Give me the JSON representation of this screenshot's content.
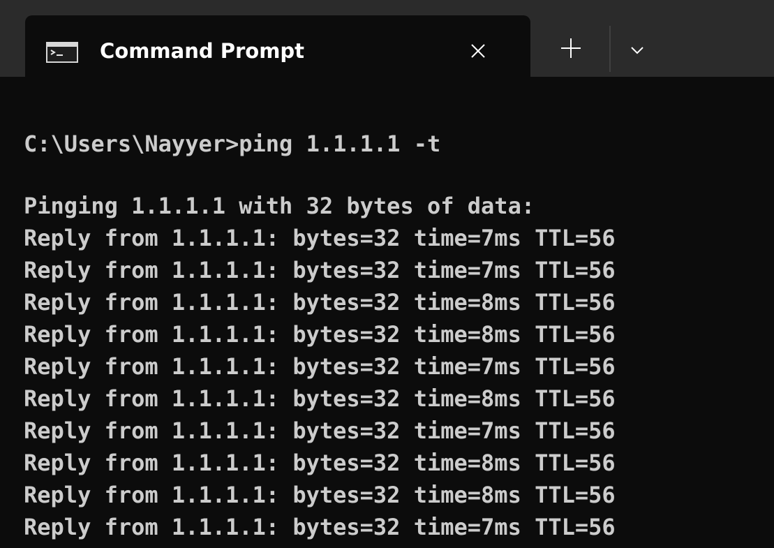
{
  "window": {
    "tab_title": "Command Prompt",
    "tab_icon": "cmd-icon",
    "close_icon": "close-icon",
    "new_tab_icon": "plus-icon",
    "dropdown_icon": "chevron-down-icon"
  },
  "terminal": {
    "command_line": "C:\\Users\\Nayyer>ping 1.1.1.1 -t",
    "header": "Pinging 1.1.1.1 with 32 bytes of data:",
    "replies": [
      "Reply from 1.1.1.1: bytes=32 time=7ms TTL=56",
      "Reply from 1.1.1.1: bytes=32 time=7ms TTL=56",
      "Reply from 1.1.1.1: bytes=32 time=8ms TTL=56",
      "Reply from 1.1.1.1: bytes=32 time=8ms TTL=56",
      "Reply from 1.1.1.1: bytes=32 time=7ms TTL=56",
      "Reply from 1.1.1.1: bytes=32 time=8ms TTL=56",
      "Reply from 1.1.1.1: bytes=32 time=7ms TTL=56",
      "Reply from 1.1.1.1: bytes=32 time=8ms TTL=56",
      "Reply from 1.1.1.1: bytes=32 time=8ms TTL=56",
      "Reply from 1.1.1.1: bytes=32 time=7ms TTL=56"
    ]
  },
  "colors": {
    "terminal_bg": "#0c0c0c",
    "titlebar_bg": "#2b2b2b",
    "text": "#cccccc",
    "tab_text": "#ffffff"
  }
}
